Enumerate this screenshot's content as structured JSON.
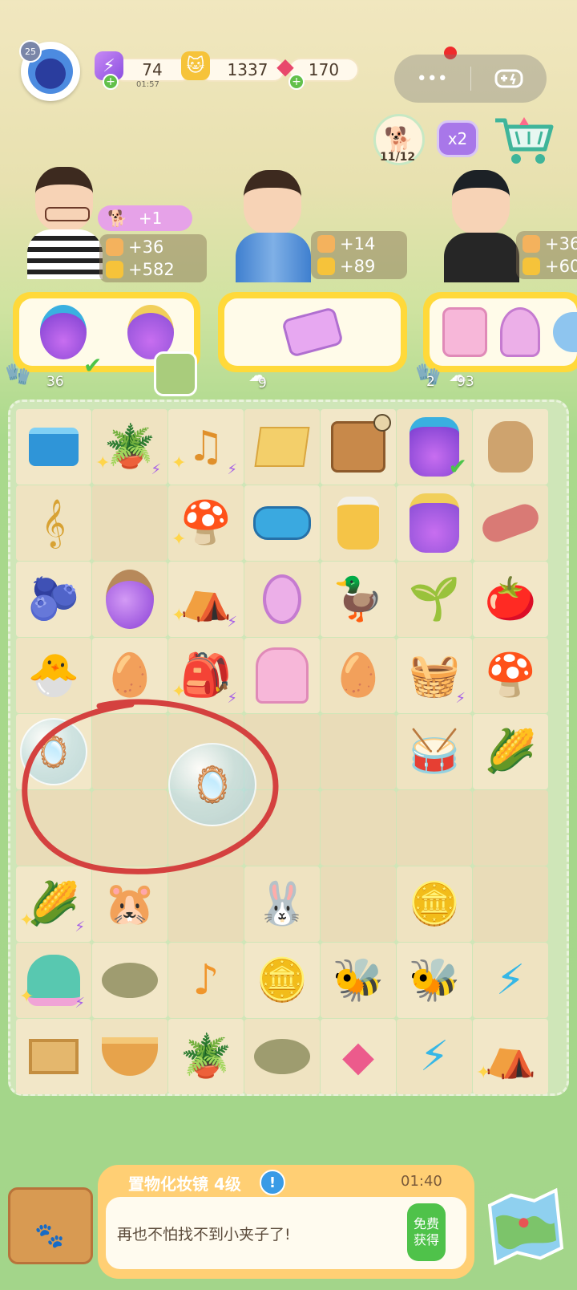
{
  "colors": {
    "accent_green": "#4fc24a",
    "energy_purple": "#a660e6",
    "gold": "#ffd93a"
  },
  "topbar": {
    "level": "25",
    "energy": {
      "value": "74",
      "timer": "01:57",
      "icon": "lightning-icon"
    },
    "coins": {
      "value": "1337",
      "icon": "cat-coin-icon"
    },
    "gems": {
      "value": "170",
      "icon": "ruby-gem-icon"
    },
    "capsule": {
      "more_icon": "•••",
      "game_icon": "gamepad-icon"
    },
    "pet_counter": "11/12",
    "x2_label": "x2",
    "shop_icon": "shopping-cart-icon"
  },
  "customers": [
    {
      "bonus": "+1",
      "lotus": "+36",
      "coins": "+582",
      "hand_count": "36",
      "cloud_icon": "cloud-icon"
    },
    {
      "lotus": "+14",
      "coins": "+89",
      "cloud_count": "9"
    },
    {
      "lotus": "+36",
      "coins": "+60",
      "hand_count": "2",
      "cloud_count": "93"
    }
  ],
  "board": {
    "rows": [
      [
        "wallet",
        "plant",
        "music",
        "bag",
        "box",
        "jar-check",
        "sack"
      ],
      [
        "harp",
        "",
        "mushroom",
        "purse",
        "honey",
        "jam",
        "sausage"
      ],
      [
        "blueberry",
        "potion",
        "tent",
        "mirror",
        "duck",
        "sprout",
        "tomato"
      ],
      [
        "chick",
        "egg",
        "backpack",
        "vanity",
        "nest",
        "basket",
        "mushrooms"
      ],
      [
        "bubble-vanity",
        "",
        "",
        "",
        "",
        "drum",
        "corn"
      ],
      [
        "",
        "bubble-mirror",
        "",
        "",
        "",
        "",
        ""
      ],
      [
        "corn-basket",
        "hamster",
        "",
        "bunny",
        "",
        "coins",
        ""
      ],
      [
        "pet-bed",
        "nest2",
        "note",
        "coin-pile",
        "bee",
        "bee2",
        "energy"
      ],
      [
        "crate",
        "bowl",
        "plant2",
        "nest3",
        "gems",
        "energy2",
        "tent2"
      ]
    ]
  },
  "bottom": {
    "title": "置物化妆镜 4级",
    "timer": "01:40",
    "message": "再也不怕找不到小夹子了!",
    "free_btn": [
      "免费",
      "获得"
    ]
  }
}
